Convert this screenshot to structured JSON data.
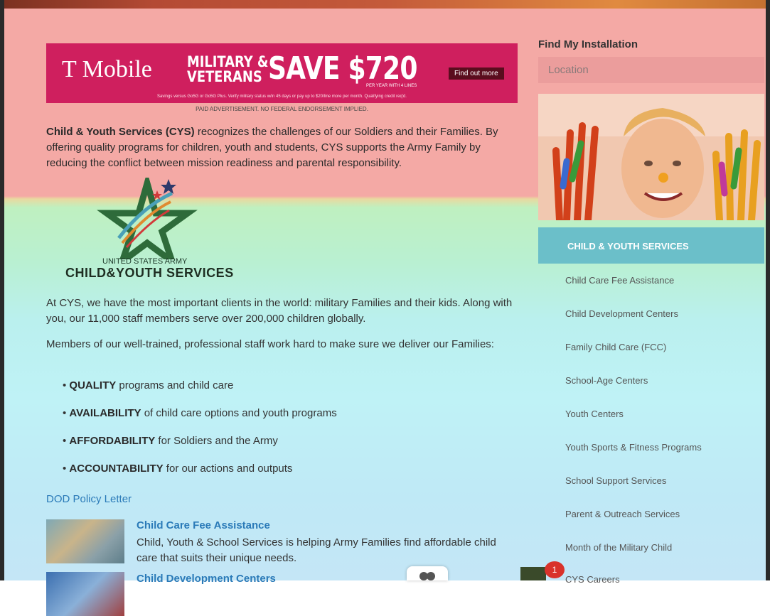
{
  "ad": {
    "brand": "T Mobile",
    "line1": "MILITARY &",
    "line2": "VETERANS",
    "save": "SAVE $720",
    "per_year": "PER YEAR WITH 4 LINES",
    "cta": "Find out more",
    "fine_print": "Savings versus Go5G or Go5G Plus. Verify military status w/in 45 days or pay up to $20/line more per month. Qualifying credit req'd.",
    "paid": "PAID ADVERTISEMENT. NO FEDERAL ENDORSEMENT IMPLIED."
  },
  "intro": {
    "bold": "Child & Youth Services (CYS)",
    "text": " recognizes the challenges of our Soldiers and their Families. By offering quality programs for children, youth and students, CYS supports the Army Family by reducing the conflict between mission readiness and parental responsibility."
  },
  "logo": {
    "line1": "UNITED STATES ARMY",
    "line2": "CHILD&YOUTH SERVICES"
  },
  "body": {
    "p1": "At CYS, we have the most important clients in the world: military Families and their kids. Along with you, our 11,000 staff members serve over 200,000 children globally.",
    "p2": "Members of our well-trained, professional staff work hard to make sure we deliver our Families:",
    "bullets": [
      {
        "bold": "QUALITY",
        "text": " programs and child care"
      },
      {
        "bold": "AVAILABILITY",
        "text": " of child care options and youth programs"
      },
      {
        "bold": "AFFORDABILITY",
        "text": " for Soldiers and the Army"
      },
      {
        "bold": "ACCOUNTABILITY",
        "text": " for our actions and outputs"
      }
    ],
    "dod_link": "DOD Policy Letter"
  },
  "cards": [
    {
      "title": "Child Care Fee Assistance",
      "desc": "Child, Youth & School Services is helping Army Families find affordable child care that suits their unique needs."
    },
    {
      "title": "Child Development Centers",
      "desc": ""
    }
  ],
  "sidebar": {
    "find_title": "Find My Installation",
    "location_placeholder": "Location",
    "nav_header": "CHILD & YOUTH SERVICES",
    "nav_items": [
      "Child Care Fee Assistance",
      "Child Development Centers",
      "Family Child Care (FCC)",
      "School-Age Centers",
      "Youth Centers",
      "Youth Sports & Fitness Programs",
      "School Support Services",
      "Parent & Outreach Services",
      "Month of the Military Child",
      "CYS Careers"
    ]
  },
  "notification": {
    "count": "1"
  },
  "colors": {
    "accent": "#2a7ab8",
    "nav_header": "#6bbfc9",
    "ad_bg": "#cf1f5e"
  }
}
